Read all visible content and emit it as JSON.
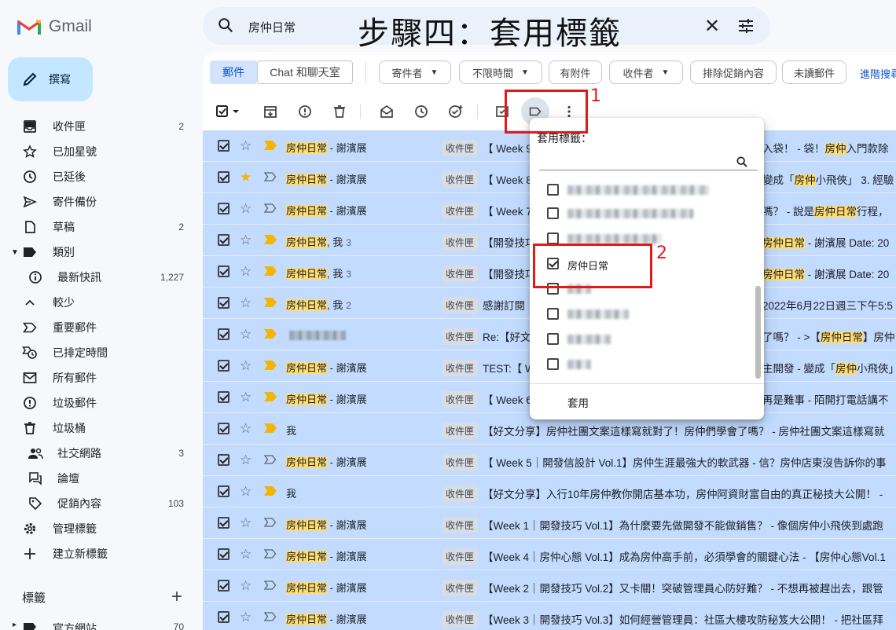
{
  "app": {
    "name": "Gmail"
  },
  "search": {
    "query": "房仲日常"
  },
  "overlay_title": "步驟四：套用標籤",
  "compose": {
    "label": "撰寫"
  },
  "nav": [
    {
      "name": "inbox",
      "icon": "inbox-icon",
      "label": "收件匣",
      "count": "2"
    },
    {
      "name": "starred",
      "icon": "star-icon",
      "label": "已加星號",
      "count": ""
    },
    {
      "name": "snoozed",
      "icon": "clock-icon",
      "label": "已延後",
      "count": ""
    },
    {
      "name": "sent",
      "icon": "send-icon",
      "label": "寄件備份",
      "count": ""
    },
    {
      "name": "drafts",
      "icon": "draft-icon",
      "label": "草稿",
      "count": "2"
    },
    {
      "name": "categories",
      "icon": "label-icon",
      "label": "類別",
      "count": ""
    },
    {
      "name": "updates",
      "icon": "info-icon",
      "label": "最新快訊",
      "count": "1,227"
    },
    {
      "name": "less",
      "icon": "chevron-up-icon",
      "label": "較少",
      "count": ""
    },
    {
      "name": "important",
      "icon": "important-icon",
      "label": "重要郵件",
      "count": ""
    },
    {
      "name": "scheduled",
      "icon": "scheduled-icon",
      "label": "已排定時間",
      "count": ""
    },
    {
      "name": "all-mail",
      "icon": "mail-icon",
      "label": "所有郵件",
      "count": ""
    },
    {
      "name": "spam",
      "icon": "spam-icon",
      "label": "垃圾郵件",
      "count": ""
    },
    {
      "name": "trash",
      "icon": "trash-icon",
      "label": "垃圾桶",
      "count": ""
    },
    {
      "name": "social",
      "icon": "people-icon",
      "label": "社交網路",
      "count": "3"
    },
    {
      "name": "forums",
      "icon": "forum-icon",
      "label": "論壇",
      "count": ""
    },
    {
      "name": "promotions",
      "icon": "tag-icon",
      "label": "促銷內容",
      "count": "103"
    },
    {
      "name": "manage-labels",
      "icon": "gear-icon",
      "label": "管理標籤",
      "count": ""
    },
    {
      "name": "new-label",
      "icon": "plus-icon",
      "label": "建立新標籤",
      "count": ""
    }
  ],
  "labels_section": {
    "title": "標籤"
  },
  "last_label": {
    "label": "官方網站",
    "count": "70"
  },
  "tabs": {
    "mail": "郵件",
    "chat": "Chat 和聊天室"
  },
  "filters": [
    {
      "label": "寄件者",
      "dropdown": true
    },
    {
      "label": "不限時間",
      "dropdown": true
    },
    {
      "label": "有附件",
      "dropdown": false
    },
    {
      "label": "收件者",
      "dropdown": true
    },
    {
      "label": "排除促銷內容",
      "dropdown": false
    },
    {
      "label": "未讀郵件",
      "dropdown": false
    }
  ],
  "advanced_search": "進階搜尋",
  "rows": [
    {
      "starred": false,
      "important": true,
      "sender_hl": "房仲日常",
      "sender_rest": " - 謝濱展",
      "count": "",
      "tag": "收件匣",
      "subject": "【 Week 9",
      "tail_a": "入袋！ - 袋！",
      "tail_hl": "房仲",
      "tail_b": "入門款除"
    },
    {
      "starred": true,
      "important": false,
      "sender_hl": "房仲日常",
      "sender_rest": " - 謝濱展",
      "count": "",
      "tag": "收件匣",
      "subject": "【 Week 8",
      "tail_a": "變成「",
      "tail_hl": "房仲",
      "tail_b": "小飛俠」 3. 經驗"
    },
    {
      "starred": false,
      "important": false,
      "sender_hl": "房仲日常",
      "sender_rest": " - 謝濱展",
      "count": "",
      "tag": "收件匣",
      "subject": "【 Week 7",
      "tail_a": "嗎？ - 說是",
      "tail_hl": "房仲日常",
      "tail_b": "行程，"
    },
    {
      "starred": false,
      "important": true,
      "sender_hl": "房仲日常",
      "sender_rest": ", 我",
      "count": "3",
      "tag": "收件匣",
      "subject": "【開發技巧",
      "tail_a": "",
      "tail_hl": "房仲日常",
      "tail_b": " - 謝濱展 Date: 20"
    },
    {
      "starred": false,
      "important": true,
      "sender_hl": "房仲日常",
      "sender_rest": ", 我",
      "count": "3",
      "tag": "收件匣",
      "subject": "【開發技巧",
      "tail_a": "",
      "tail_hl": "房仲日常",
      "tail_b": " - 謝濱展 Date: 20"
    },
    {
      "starred": false,
      "important": true,
      "sender_hl": "房仲日常",
      "sender_rest": ", 我",
      "count": "2",
      "tag": "收件匣",
      "subject": "感謝訂閱",
      "tail_a": "2022年6月22日週三下午5:5",
      "tail_hl": "",
      "tail_b": ""
    },
    {
      "starred": false,
      "important": true,
      "sender_hl": "",
      "sender_rest": "",
      "count": "",
      "blur": true,
      "tag": "收件匣",
      "subject": "Re:【好文",
      "tail_a": "了嗎？ - >【",
      "tail_hl": "房仲日常",
      "tail_b": "】房仲"
    },
    {
      "starred": false,
      "important": true,
      "sender_hl": "房仲日常",
      "sender_rest": " - 謝濱展",
      "count": "",
      "tag": "收件匣",
      "subject": "TEST:【 W",
      "tail_a": "主開發 - 變成「",
      "tail_hl": "房仲",
      "tail_b": "小飛俠」"
    },
    {
      "starred": false,
      "important": true,
      "sender_hl": "房仲日常",
      "sender_rest": " - 謝濱展",
      "count": "",
      "tag": "收件匣",
      "subject": "【 Week 6",
      "tail_a": "再是難事 - 陌開打電話講不",
      "tail_hl": "",
      "tail_b": ""
    },
    {
      "starred": false,
      "important": true,
      "sender_hl": "",
      "sender_rest": "我",
      "count": "",
      "tag": "收件匣",
      "subject": "【好文分享】房仲社團文案這樣寫就對了！房仲們學會了嗎？ - 房仲社團文案這樣寫就",
      "tail_a": "",
      "tail_hl": "",
      "tail_b": ""
    },
    {
      "starred": false,
      "important": false,
      "sender_hl": "房仲日常",
      "sender_rest": " - 謝濱展",
      "count": "",
      "tag": "收件匣",
      "subject": "【 Week 5｜開發信設計 Vol.1】房仲生涯最強大的軟武器 - 信？房仲店東沒告訴你的事",
      "tail_a": "",
      "tail_hl": "",
      "tail_b": ""
    },
    {
      "starred": false,
      "important": true,
      "sender_hl": "",
      "sender_rest": "我",
      "count": "",
      "tag": "收件匣",
      "subject": "【好文分享】入行10年房仲教你開店基本功，房仲阿資財富自由的真正秘技大公開！ -",
      "tail_a": "",
      "tail_hl": "",
      "tail_b": ""
    },
    {
      "starred": false,
      "important": false,
      "sender_hl": "房仲日常",
      "sender_rest": " - 謝濱展",
      "count": "",
      "tag": "收件匣",
      "subject": "【Week 1｜開發技巧 Vol.1】為什麼要先做開發不能做銷售？ - 像個房仲小飛俠到處跑",
      "tail_a": "",
      "tail_hl": "",
      "tail_b": ""
    },
    {
      "starred": false,
      "important": false,
      "sender_hl": "房仲日常",
      "sender_rest": " - 謝濱展",
      "count": "",
      "tag": "收件匣",
      "subject": "【Week 4｜房仲心態 Vol.1】成為房仲高手前，必須學會的關鍵心法 - 【房仲心態Vol.1",
      "tail_a": "",
      "tail_hl": "",
      "tail_b": ""
    },
    {
      "starred": false,
      "important": false,
      "sender_hl": "房仲日常",
      "sender_rest": " - 謝濱展",
      "count": "",
      "tag": "收件匣",
      "subject": "【Week 2｜開發技巧 Vol.2】又卡關！突破管理員心防好難？ - 不想再被趕出去，跟管",
      "tail_a": "",
      "tail_hl": "",
      "tail_b": ""
    },
    {
      "starred": false,
      "important": false,
      "sender_hl": "房仲日常",
      "sender_rest": " - 謝濱展",
      "count": "",
      "tag": "收件匣",
      "subject": "【Week 3｜開發技巧 Vol.3】如何經營管理員：社區大樓攻防秘笈大公開！ - 把社區拜",
      "tail_a": "",
      "tail_hl": "",
      "tail_b": ""
    }
  ],
  "label_popup": {
    "title": "套用標籤：",
    "search_placeholder": "",
    "items": [
      {
        "label": "",
        "blurred": true,
        "checked": false,
        "blur_w": 180
      },
      {
        "label": "",
        "blurred": true,
        "checked": false,
        "blur_w": 160
      },
      {
        "label": "",
        "blurred": true,
        "checked": false,
        "blur_w": 120
      },
      {
        "label": "房仲日常",
        "blurred": false,
        "checked": true,
        "blur_w": 0
      },
      {
        "label": "",
        "blurred": true,
        "checked": false,
        "blur_w": 30
      },
      {
        "label": "",
        "blurred": true,
        "checked": false,
        "blur_w": 78
      },
      {
        "label": "",
        "blurred": true,
        "checked": false,
        "blur_w": 55
      },
      {
        "label": "",
        "blurred": true,
        "checked": false,
        "blur_w": 30
      }
    ],
    "apply_label": "套用"
  },
  "annotations": {
    "step1": "1",
    "step2": "2",
    "color": "#e0191b"
  },
  "colors": {
    "selected_row": "#c2dbff",
    "highlight": "#fddc72",
    "accent": "#0b57d0",
    "compose_bg": "#c2e7ff"
  }
}
